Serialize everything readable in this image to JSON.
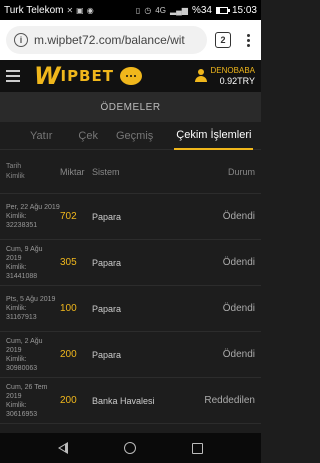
{
  "status_bar": {
    "carrier": "Turk Telekom",
    "battery": "%34",
    "battery_level": 0.34,
    "time": "15:03",
    "network": "4G"
  },
  "browser": {
    "url": "m.wipbet72.com/balance/wit",
    "tab_count": "2"
  },
  "header": {
    "logo_w": "W",
    "logo_rest": "IPBET",
    "username": "DENOBABA",
    "balance": "0.92TRY"
  },
  "section": {
    "title": "ÖDEMELER"
  },
  "tabs": [
    {
      "label": "Yatır",
      "active": false
    },
    {
      "label": "Çek",
      "active": false
    },
    {
      "label": "Geçmiş",
      "active": false
    },
    {
      "label": "Çekim İşlemleri",
      "active": true
    }
  ],
  "table": {
    "headers": {
      "date": "Tarih",
      "id": "Kimlik",
      "amount": "Miktar",
      "system": "Sistem",
      "status": "Durum"
    },
    "rows": [
      {
        "date": "Per, 22 Ağu 2019",
        "id_label": "Kimlik:",
        "id": "32238351",
        "amount": "702",
        "system": "Papara",
        "status": "Ödendi"
      },
      {
        "date": "Cum, 9 Ağu 2019",
        "id_label": "Kimlik:",
        "id": "31441088",
        "amount": "305",
        "system": "Papara",
        "status": "Ödendi"
      },
      {
        "date": "Pts, 5 Ağu 2019",
        "id_label": "Kimlik:",
        "id": "31167913",
        "amount": "100",
        "system": "Papara",
        "status": "Ödendi"
      },
      {
        "date": "Cum, 2 Ağu 2019",
        "id_label": "Kimlik:",
        "id": "30980063",
        "amount": "200",
        "system": "Papara",
        "status": "Ödendi"
      },
      {
        "date": "Cum, 26 Tem 2019",
        "id_label": "Kimlik:",
        "id": "30616953",
        "amount": "200",
        "system": "Banka Havalesi",
        "status": "Reddedilen"
      }
    ]
  },
  "colors": {
    "accent": "#f0b71c",
    "background": "#1d1d1d"
  }
}
